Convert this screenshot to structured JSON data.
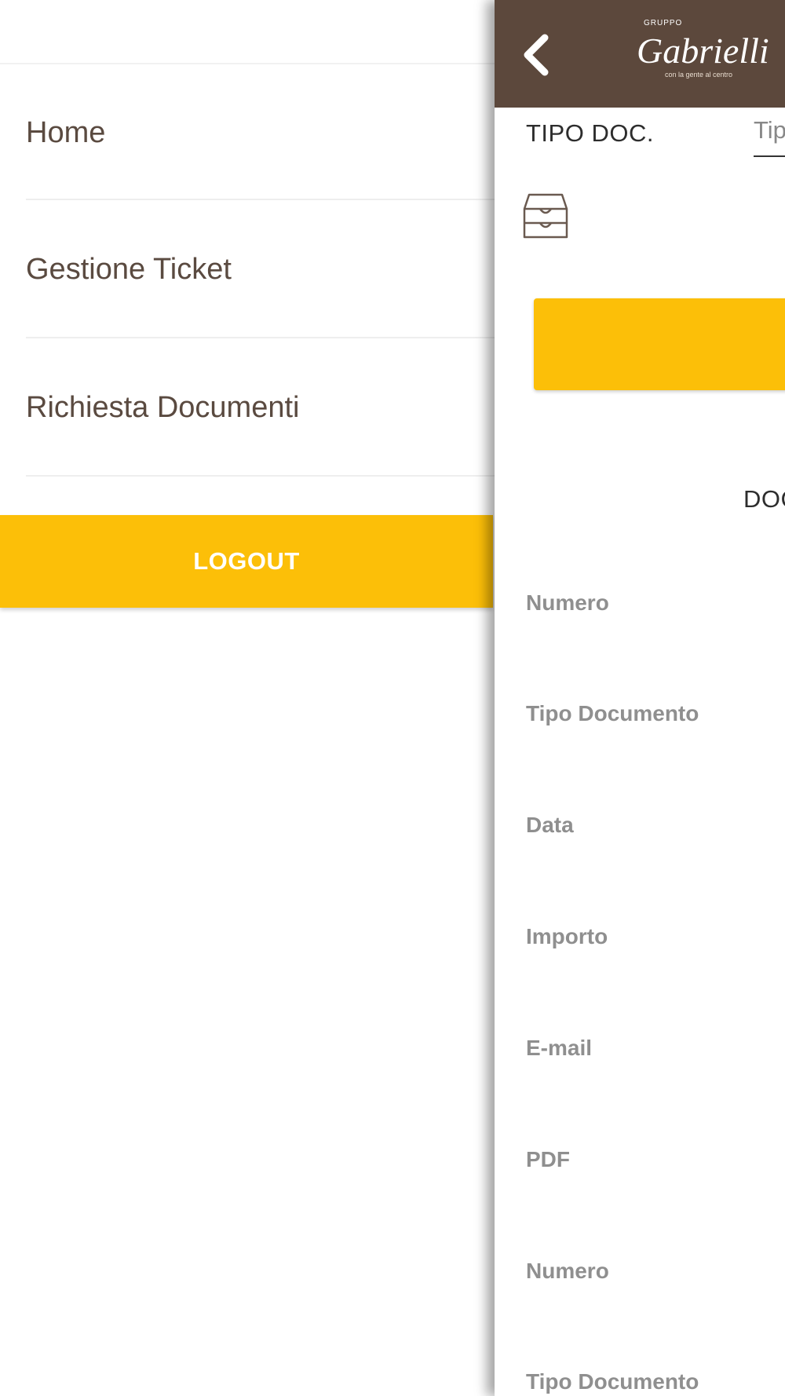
{
  "drawer": {
    "items": [
      {
        "label": "Home"
      },
      {
        "label": "Gestione Ticket"
      },
      {
        "label": "Richiesta Documenti"
      }
    ],
    "logout_label": "LOGOUT"
  },
  "header": {
    "back_icon": "chevron-left-icon",
    "logo": {
      "top": "GRUPPO",
      "name": "Gabrielli",
      "tagline": "con la gente al centro"
    }
  },
  "filter": {
    "label": "TIPO DOC.",
    "value_visible": "Tip"
  },
  "archive_icon": "archive-drawer-icon",
  "section": {
    "title_visible": "DOC"
  },
  "document_fields": [
    {
      "label": "Numero"
    },
    {
      "label": "Tipo Documento"
    },
    {
      "label": "Data"
    },
    {
      "label": "Importo"
    },
    {
      "label": "E-mail"
    },
    {
      "label": "PDF"
    },
    {
      "label": "Numero"
    },
    {
      "label": "Tipo Documento"
    }
  ],
  "colors": {
    "accent": "#FCBF08",
    "header_bg": "#5C483C",
    "menu_text": "#5A4A40",
    "field_label": "#8F8F8F"
  }
}
